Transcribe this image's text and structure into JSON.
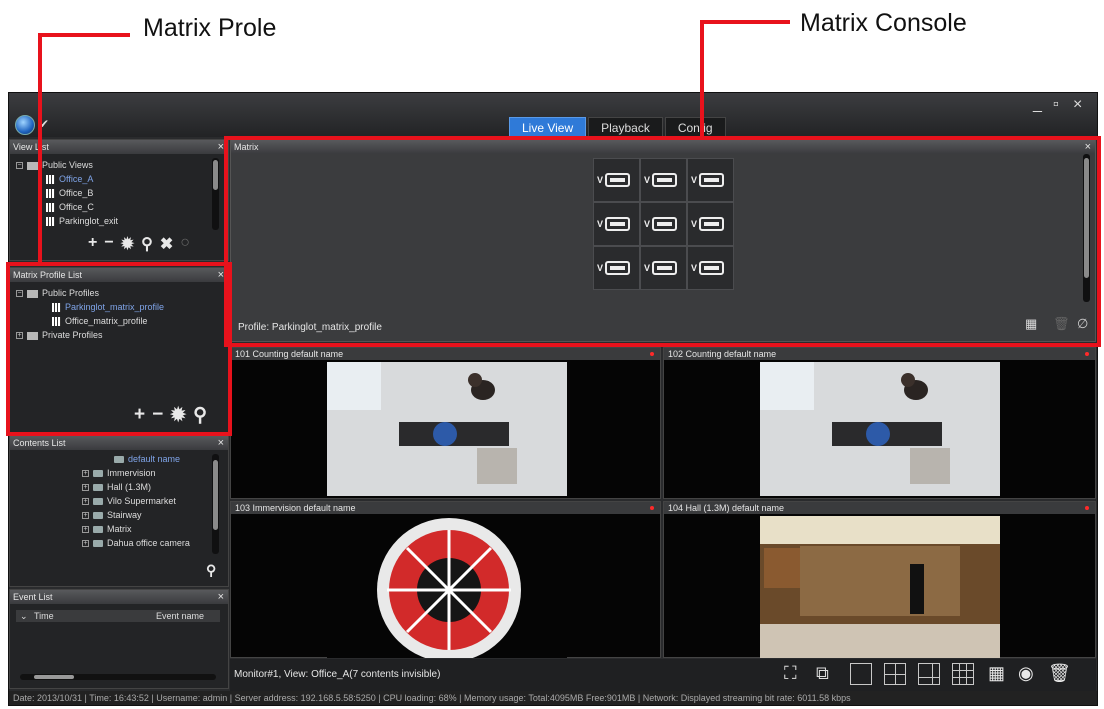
{
  "callouts": {
    "left_label": "Matrix Prole",
    "right_label": "Matrix Console"
  },
  "window": {
    "controls": [
      "_",
      "▫",
      "×"
    ]
  },
  "tabs": [
    {
      "label": "Live View",
      "active": true
    },
    {
      "label": "Playback",
      "active": false
    },
    {
      "label": "Config",
      "active": false
    }
  ],
  "view_list": {
    "title": "View List",
    "root": "Public Views",
    "items": [
      "Office_A",
      "Office_B",
      "Office_C",
      "Parkinglot_exit"
    ],
    "selected_index": 0
  },
  "matrix_profile_list": {
    "title": "Matrix Profile List",
    "public_root": "Public Profiles",
    "profiles": [
      "Parkinglot_matrix_profile",
      "Office_matrix_profile"
    ],
    "selected_index": 0,
    "private_root": "Private Profiles"
  },
  "contents_list": {
    "title": "Contents List",
    "top_item": "default name",
    "items": [
      "Immervision",
      "Hall (1.3M)",
      "Vilo Supermarket",
      "Stairway",
      "Matrix",
      "Dahua office camera"
    ]
  },
  "event_list": {
    "title": "Event List",
    "columns": [
      "Time",
      "Event name"
    ]
  },
  "matrix": {
    "title": "Matrix",
    "profile_text": "Profile: Parkinglot_matrix_profile",
    "rows": 3,
    "cols": 3,
    "cell_label": "V"
  },
  "videos": [
    {
      "label": "101  Counting  default name"
    },
    {
      "label": "102  Counting  default name"
    },
    {
      "label": "103  Immervision  default name"
    },
    {
      "label": "104  Hall (1.3M)  default name"
    }
  ],
  "bottom": {
    "monitor_text": "Monitor#1, View: Office_A(7 contents invisible)"
  },
  "status_bar": "Date: 2013/10/31  |  Time: 16:43:52  |  Username: admin  |  Server address: 192.168.5.58:5250  |  CPU loading: 68%  |  Memory usage: Total:4095MB  Free:901MB  |  Network: Displayed streaming bit rate: 6011.58 kbps"
}
